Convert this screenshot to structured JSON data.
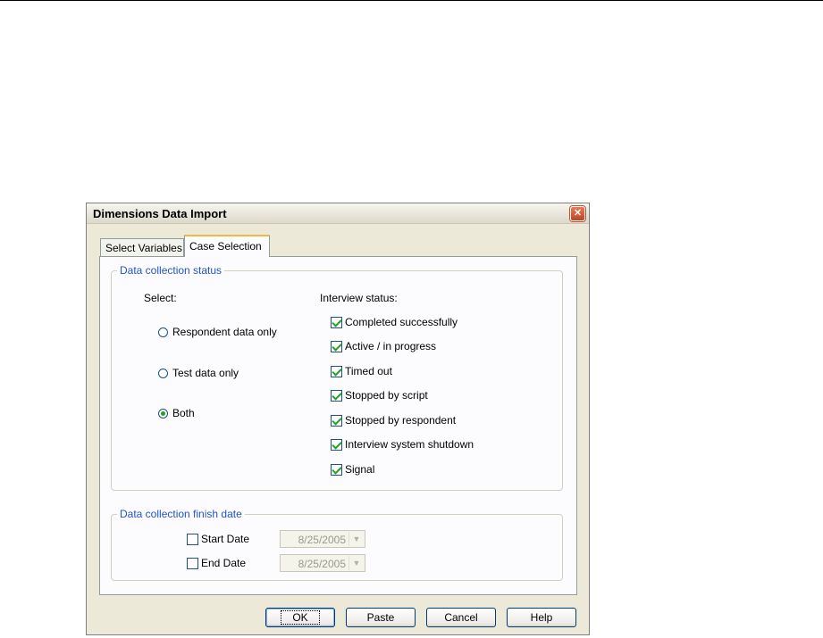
{
  "dialog": {
    "title": "Dimensions Data Import",
    "close_glyph": "✕"
  },
  "tabs": [
    {
      "label": "Select Variables",
      "active": false
    },
    {
      "label": "Case Selection",
      "active": true
    }
  ],
  "status_group": {
    "legend": "Data collection status",
    "select_label": "Select:",
    "interview_label": "Interview status:",
    "radios": [
      {
        "label": "Respondent data only",
        "selected": false
      },
      {
        "label": "Test data only",
        "selected": false
      },
      {
        "label": "Both",
        "selected": true
      }
    ],
    "checks": [
      {
        "label": "Completed successfully",
        "checked": true
      },
      {
        "label": "Active / in progress",
        "checked": true
      },
      {
        "label": "Timed out",
        "checked": true
      },
      {
        "label": "Stopped by script",
        "checked": true
      },
      {
        "label": "Stopped by respondent",
        "checked": true
      },
      {
        "label": "Interview system shutdown",
        "checked": true
      },
      {
        "label": "Signal",
        "checked": true
      }
    ]
  },
  "date_group": {
    "legend": "Data collection finish date",
    "start": {
      "label": "Start Date",
      "checked": false,
      "value": "8/25/2005"
    },
    "end": {
      "label": "End Date",
      "checked": false,
      "value": "8/25/2005"
    }
  },
  "buttons": {
    "ok": "OK",
    "paste": "Paste",
    "cancel": "Cancel",
    "help": "Help"
  },
  "icons": {
    "dropdown_arrow": "▼"
  }
}
